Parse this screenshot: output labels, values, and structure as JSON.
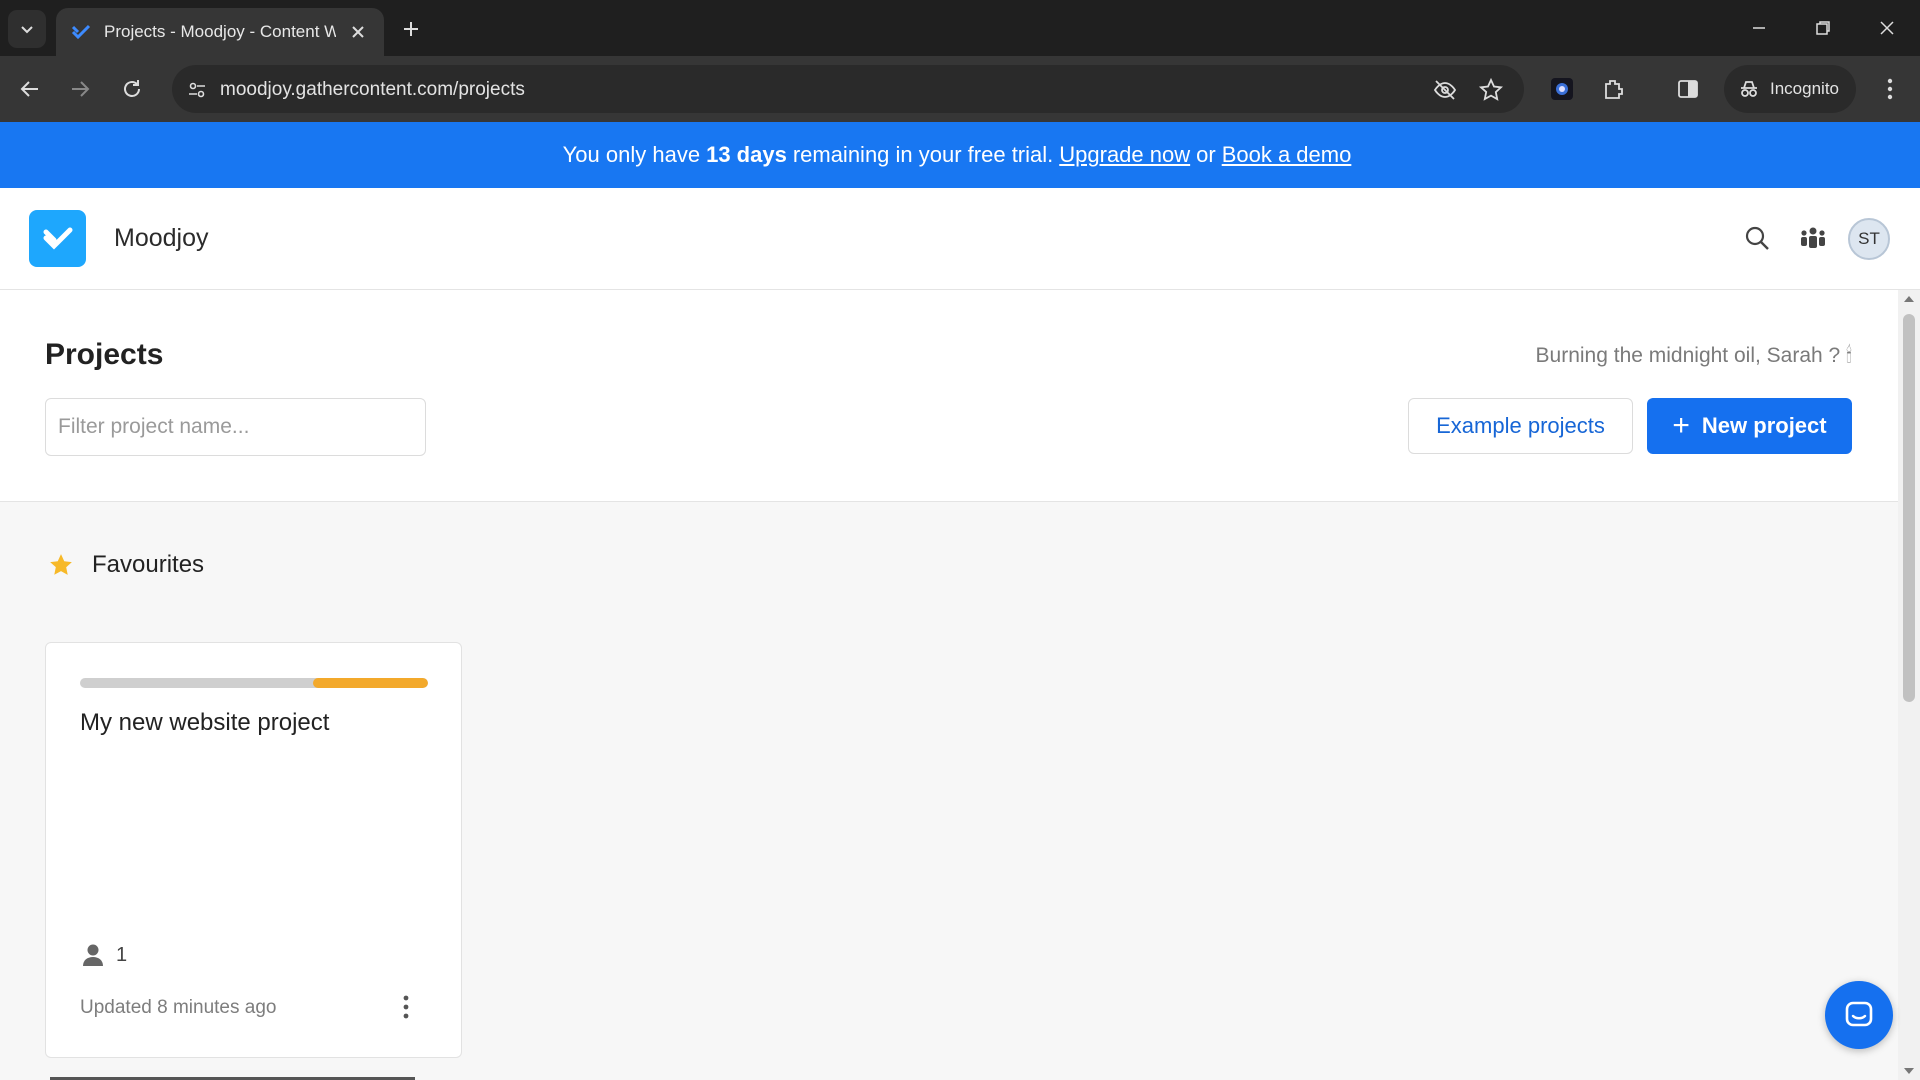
{
  "browser": {
    "tab_title": "Projects - Moodjoy - Content W",
    "url": "moodjoy.gathercontent.com/projects",
    "incognito_label": "Incognito"
  },
  "banner": {
    "prefix": "You only have",
    "days": "13 days",
    "middle": "remaining in your free trial.",
    "upgrade_link": "Upgrade now",
    "or": "or",
    "demo_link": "Book a demo",
    "color": "#1877f2"
  },
  "header": {
    "workspace_name": "Moodjoy",
    "avatar_initials": "ST",
    "logo_color": "#1ea7fd"
  },
  "projects": {
    "title": "Projects",
    "filter_placeholder": "Filter project name...",
    "greeting": "Burning the midnight oil, Sarah ? 🕯",
    "example_button": "Example projects",
    "new_button": "New project",
    "accent": "#1570ef"
  },
  "favourites": {
    "heading": "Favourites",
    "cards": [
      {
        "title": "My new website project",
        "progress_fraction": 0.33,
        "members": "1",
        "updated": "Updated 8 minutes ago"
      }
    ]
  }
}
